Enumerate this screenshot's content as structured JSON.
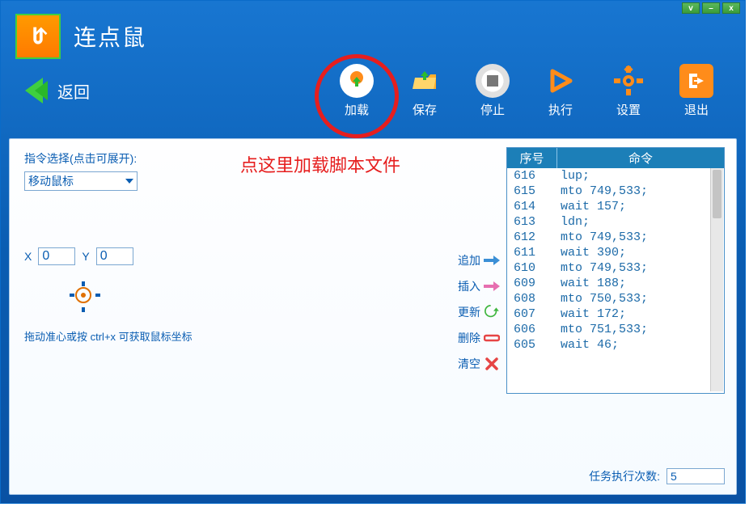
{
  "app": {
    "title": "连点鼠"
  },
  "nav": {
    "back": "返回"
  },
  "toolbar": {
    "load": "加载",
    "save": "保存",
    "stop": "停止",
    "run": "执行",
    "settings": "设置",
    "exit": "退出"
  },
  "annotation": {
    "text": "点这里加载脚本文件"
  },
  "cmdSelect": {
    "label": "指令选择(点击可展开):",
    "value": "移动鼠标"
  },
  "coords": {
    "xLabel": "X",
    "x": "0",
    "yLabel": "Y",
    "y": "0"
  },
  "hint": "拖动准心或按 ctrl+x 可获取鼠标坐标",
  "ops": {
    "append": "追加",
    "insert": "插入",
    "update": "更新",
    "delete": "删除",
    "clear": "清空"
  },
  "scriptHeaders": {
    "sn": "序号",
    "cmd": "命令"
  },
  "scriptRows": [
    {
      "sn": "616",
      "cmd": "lup;"
    },
    {
      "sn": "615",
      "cmd": "mto 749,533;"
    },
    {
      "sn": "614",
      "cmd": "wait 157;"
    },
    {
      "sn": "613",
      "cmd": "ldn;"
    },
    {
      "sn": "612",
      "cmd": "mto 749,533;"
    },
    {
      "sn": "611",
      "cmd": "wait 390;"
    },
    {
      "sn": "610",
      "cmd": "mto 749,533;"
    },
    {
      "sn": "609",
      "cmd": "wait 188;"
    },
    {
      "sn": "608",
      "cmd": "mto 750,533;"
    },
    {
      "sn": "607",
      "cmd": "wait 172;"
    },
    {
      "sn": "606",
      "cmd": "mto 751,533;"
    },
    {
      "sn": "605",
      "cmd": "wait 46;"
    }
  ],
  "execCount": {
    "label": "任务执行次数:",
    "value": "5"
  },
  "winButtons": {
    "v": "v",
    "min": "–",
    "close": "x"
  }
}
